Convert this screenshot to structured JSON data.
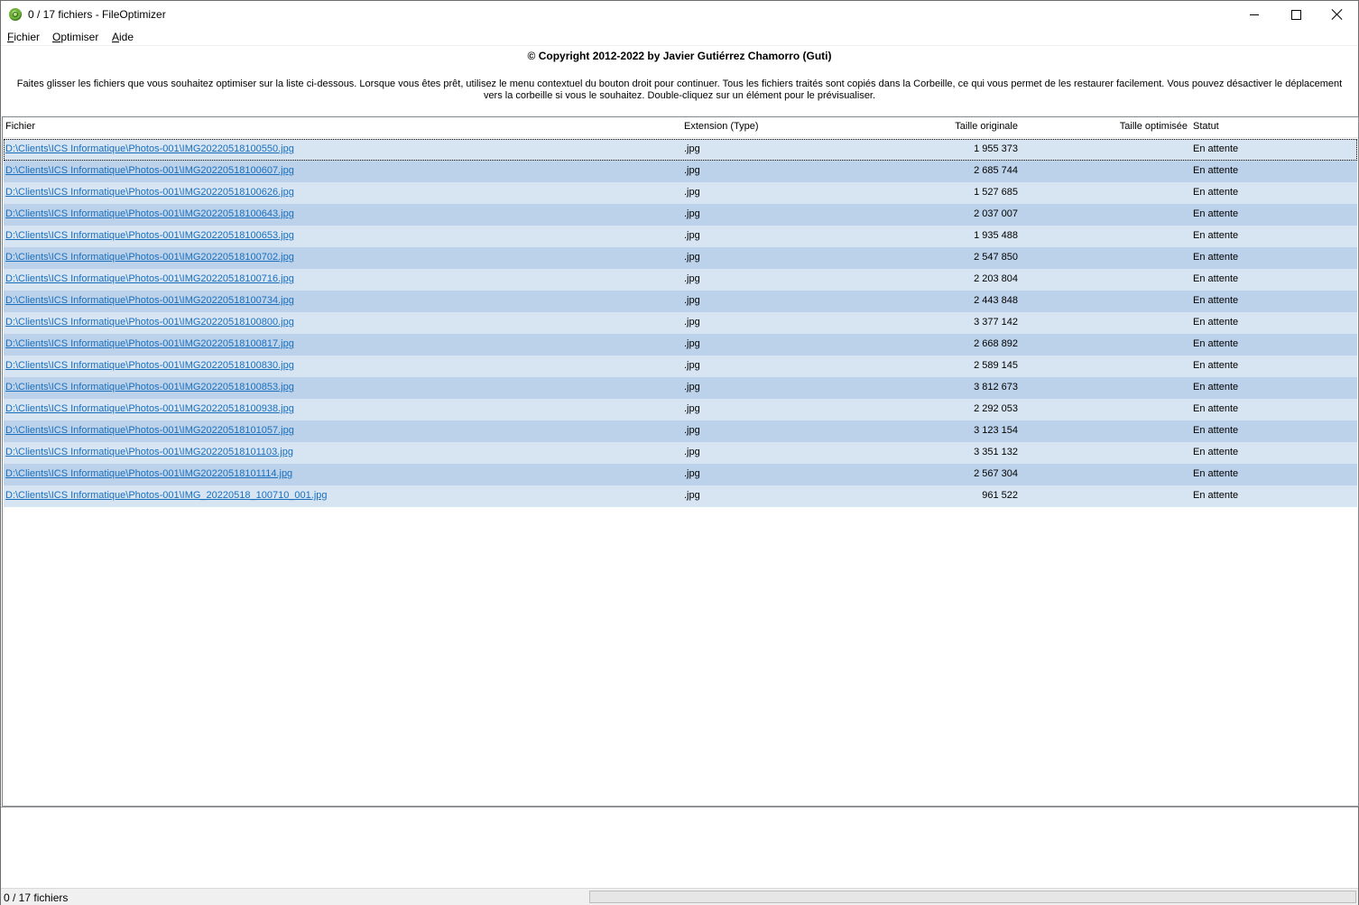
{
  "window": {
    "title": "0 / 17 fichiers - FileOptimizer"
  },
  "menu": [
    {
      "accel": "F",
      "rest": "ichier"
    },
    {
      "accel": "O",
      "rest": "ptimiser"
    },
    {
      "accel": "A",
      "rest": "ide"
    }
  ],
  "header": {
    "copyright": "© Copyright 2012-2022 by Javier Gutiérrez Chamorro (Guti)",
    "instructions": "Faites glisser les fichiers que vous souhaitez optimiser sur la liste ci-dessous. Lorsque vous êtes prêt, utilisez le menu contextuel du bouton droit pour continuer. Tous les fichiers traités sont copiés dans la Corbeille, ce qui vous permet de les restaurer facilement. Vous pouvez désactiver le déplacement vers la corbeille si vous le souhaitez. Double-cliquez sur un élément pour le prévisualiser."
  },
  "table": {
    "columns": {
      "file": "Fichier",
      "ext": "Extension (Type)",
      "original": "Taille originale",
      "optimized": "Taille optimisée",
      "status": "Statut"
    },
    "rows": [
      {
        "file": "D:\\Clients\\ICS Informatique\\Photos-001\\IMG20220518100550.jpg",
        "ext": ".jpg",
        "original": "1 955 373",
        "optimized": "",
        "status": "En attente"
      },
      {
        "file": "D:\\Clients\\ICS Informatique\\Photos-001\\IMG20220518100607.jpg",
        "ext": ".jpg",
        "original": "2 685 744",
        "optimized": "",
        "status": "En attente"
      },
      {
        "file": "D:\\Clients\\ICS Informatique\\Photos-001\\IMG20220518100626.jpg",
        "ext": ".jpg",
        "original": "1 527 685",
        "optimized": "",
        "status": "En attente"
      },
      {
        "file": "D:\\Clients\\ICS Informatique\\Photos-001\\IMG20220518100643.jpg",
        "ext": ".jpg",
        "original": "2 037 007",
        "optimized": "",
        "status": "En attente"
      },
      {
        "file": "D:\\Clients\\ICS Informatique\\Photos-001\\IMG20220518100653.jpg",
        "ext": ".jpg",
        "original": "1 935 488",
        "optimized": "",
        "status": "En attente"
      },
      {
        "file": "D:\\Clients\\ICS Informatique\\Photos-001\\IMG20220518100702.jpg",
        "ext": ".jpg",
        "original": "2 547 850",
        "optimized": "",
        "status": "En attente"
      },
      {
        "file": "D:\\Clients\\ICS Informatique\\Photos-001\\IMG20220518100716.jpg",
        "ext": ".jpg",
        "original": "2 203 804",
        "optimized": "",
        "status": "En attente"
      },
      {
        "file": "D:\\Clients\\ICS Informatique\\Photos-001\\IMG20220518100734.jpg",
        "ext": ".jpg",
        "original": "2 443 848",
        "optimized": "",
        "status": "En attente"
      },
      {
        "file": "D:\\Clients\\ICS Informatique\\Photos-001\\IMG20220518100800.jpg",
        "ext": ".jpg",
        "original": "3 377 142",
        "optimized": "",
        "status": "En attente"
      },
      {
        "file": "D:\\Clients\\ICS Informatique\\Photos-001\\IMG20220518100817.jpg",
        "ext": ".jpg",
        "original": "2 668 892",
        "optimized": "",
        "status": "En attente"
      },
      {
        "file": "D:\\Clients\\ICS Informatique\\Photos-001\\IMG20220518100830.jpg",
        "ext": ".jpg",
        "original": "2 589 145",
        "optimized": "",
        "status": "En attente"
      },
      {
        "file": "D:\\Clients\\ICS Informatique\\Photos-001\\IMG20220518100853.jpg",
        "ext": ".jpg",
        "original": "3 812 673",
        "optimized": "",
        "status": "En attente"
      },
      {
        "file": "D:\\Clients\\ICS Informatique\\Photos-001\\IMG20220518100938.jpg",
        "ext": ".jpg",
        "original": "2 292 053",
        "optimized": "",
        "status": "En attente"
      },
      {
        "file": "D:\\Clients\\ICS Informatique\\Photos-001\\IMG20220518101057.jpg",
        "ext": ".jpg",
        "original": "3 123 154",
        "optimized": "",
        "status": "En attente"
      },
      {
        "file": "D:\\Clients\\ICS Informatique\\Photos-001\\IMG20220518101103.jpg",
        "ext": ".jpg",
        "original": "3 351 132",
        "optimized": "",
        "status": "En attente"
      },
      {
        "file": "D:\\Clients\\ICS Informatique\\Photos-001\\IMG20220518101114.jpg",
        "ext": ".jpg",
        "original": "2 567 304",
        "optimized": "",
        "status": "En attente"
      },
      {
        "file": "D:\\Clients\\ICS Informatique\\Photos-001\\IMG_20220518_100710_001.jpg",
        "ext": ".jpg",
        "original": "961 522",
        "optimized": "",
        "status": "En attente"
      }
    ]
  },
  "statusbar": {
    "text": "0 / 17 fichiers",
    "progress": 0
  },
  "colors": {
    "row_odd": "#d7e5f2",
    "row_even": "#bcd2ea",
    "link": "#1a6fbd",
    "progress_fill": "#06b025"
  }
}
